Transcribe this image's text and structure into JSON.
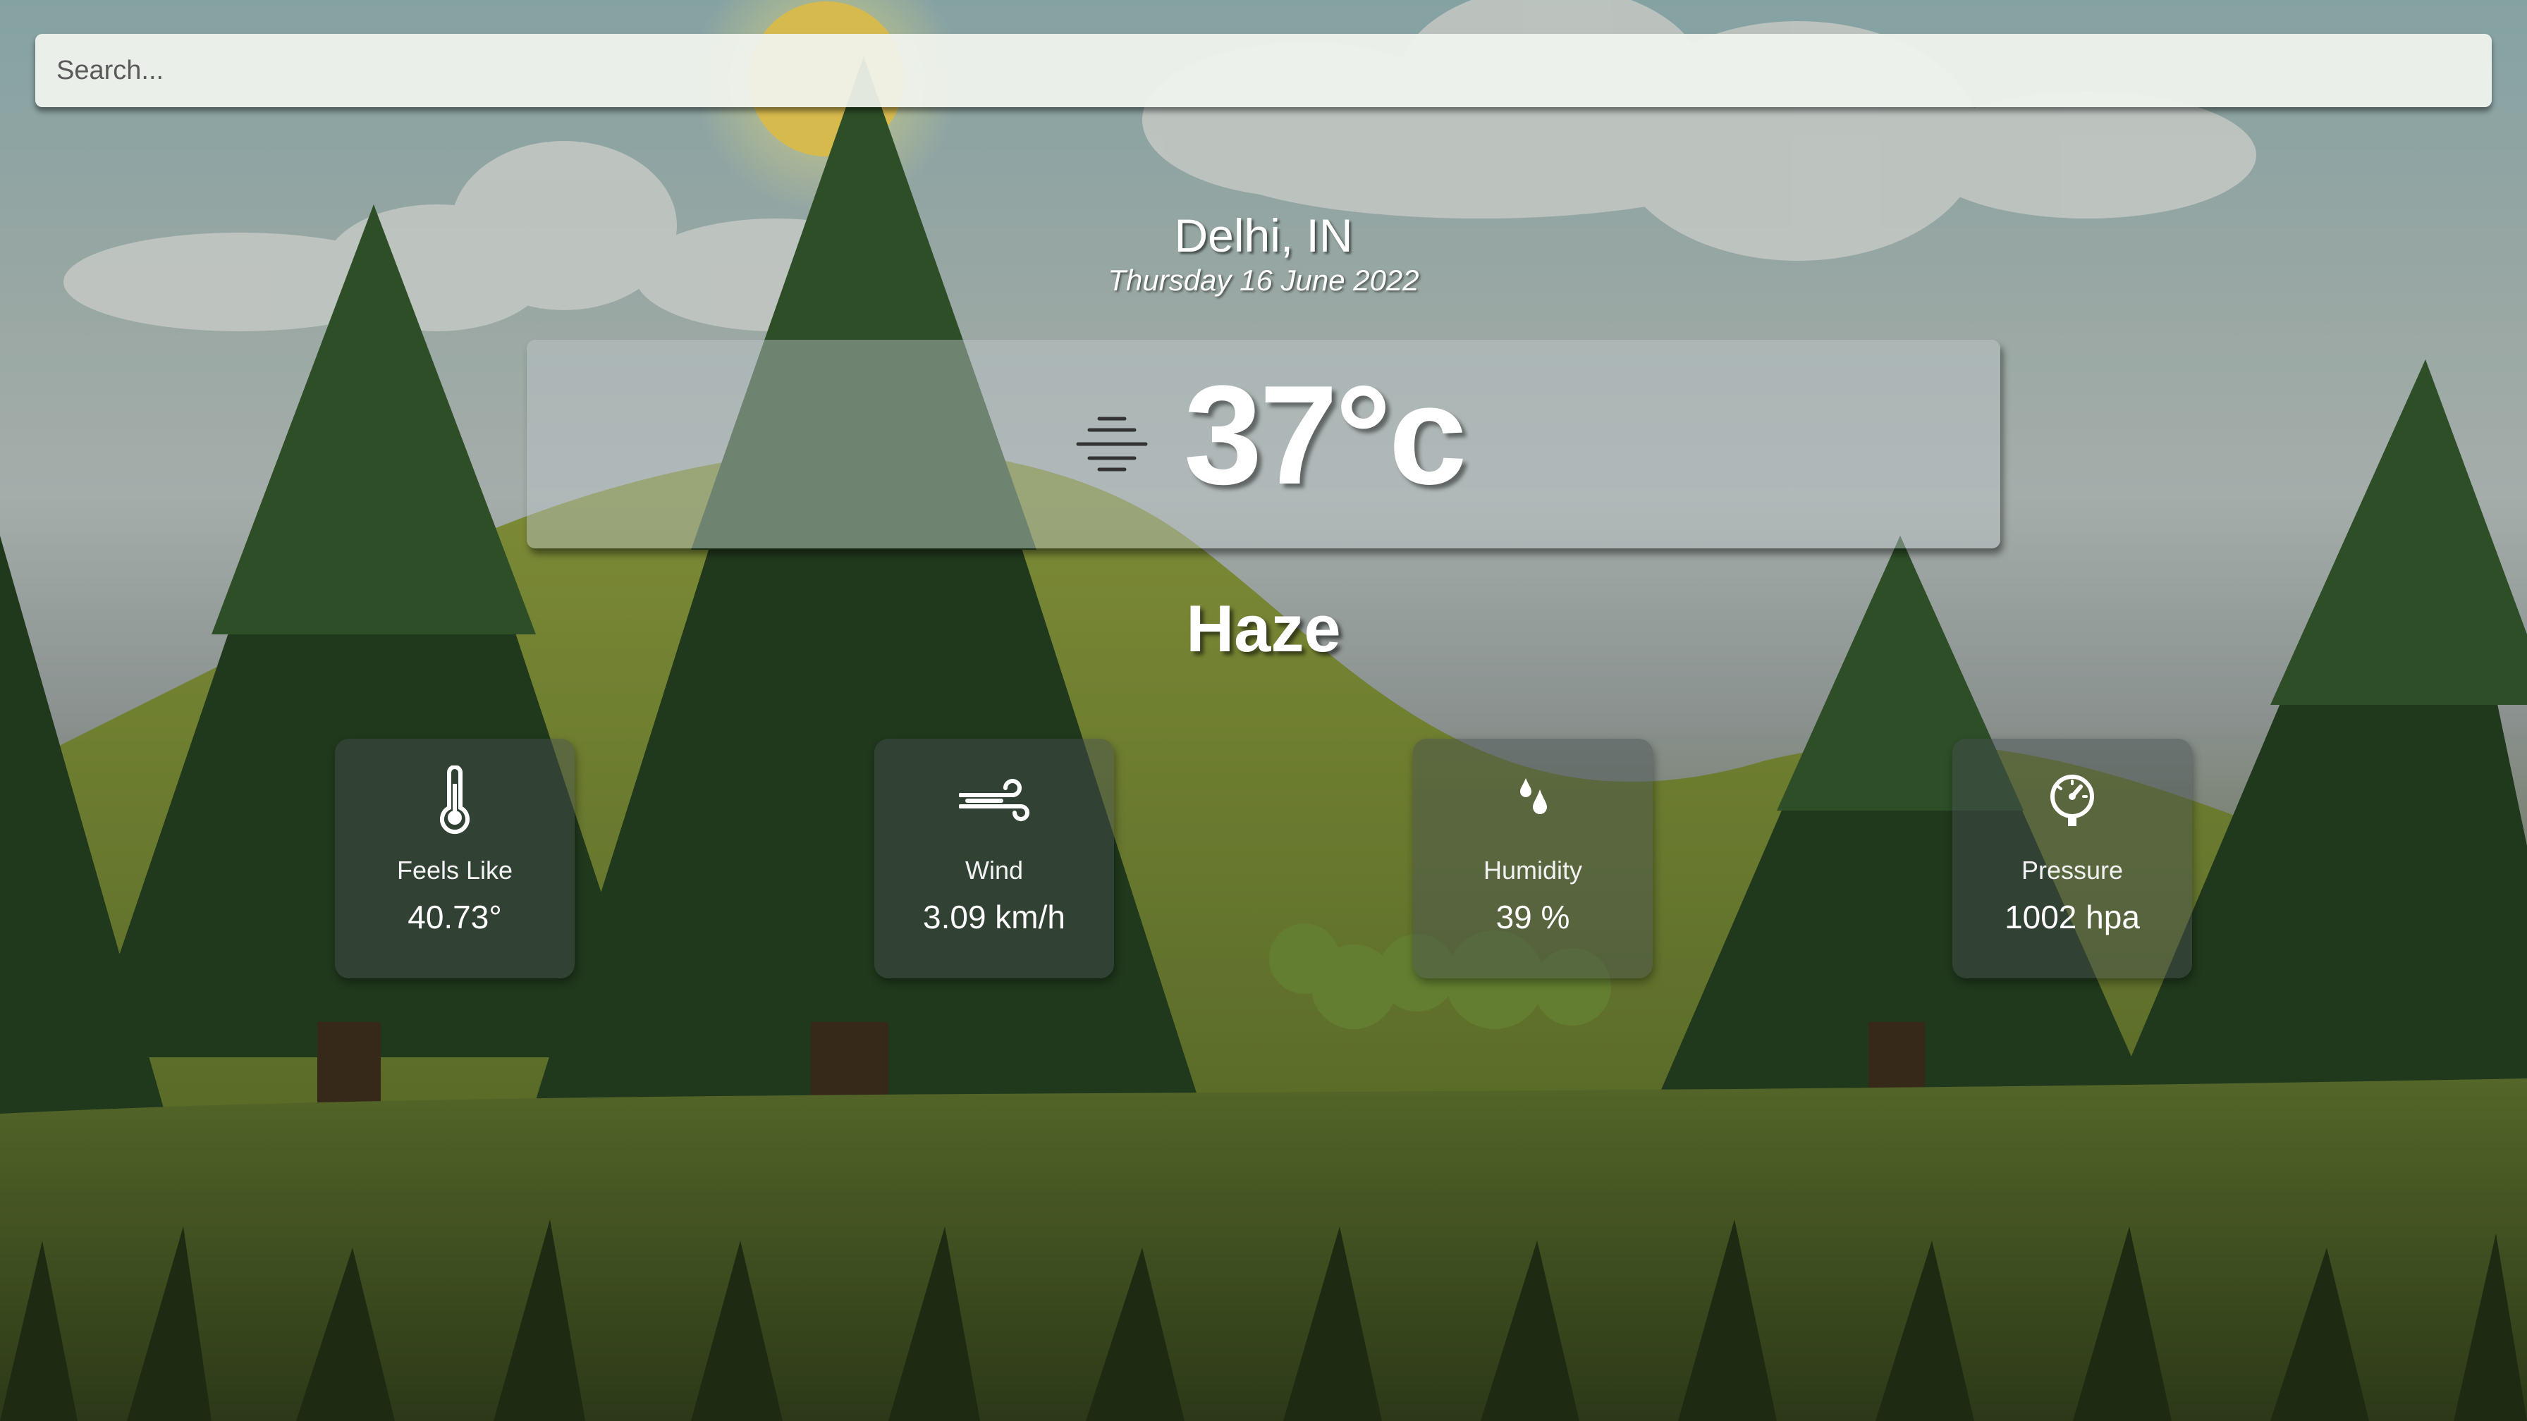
{
  "search": {
    "placeholder": "Search..."
  },
  "location": {
    "city": "Delhi, IN",
    "date": "Thursday 16 June 2022"
  },
  "current": {
    "temperature": "37°c",
    "condition": "Haze",
    "icon": "haze-icon"
  },
  "stats": [
    {
      "label": "Feels Like",
      "value": "40.73°",
      "icon": "thermometer-icon"
    },
    {
      "label": "Wind",
      "value": "3.09 km/h",
      "icon": "wind-icon"
    },
    {
      "label": "Humidity",
      "value": "39 %",
      "icon": "humidity-icon"
    },
    {
      "label": "Pressure",
      "value": "1002 hpa",
      "icon": "pressure-gauge-icon"
    }
  ],
  "colors": {
    "text": "#ffffff",
    "search_bg": "#f1f4ee",
    "card_bg": "#bec6ca"
  }
}
